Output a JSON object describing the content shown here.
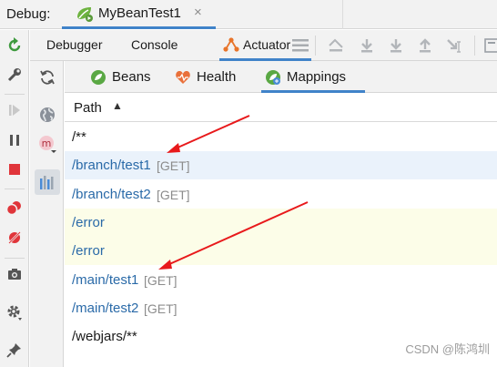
{
  "debug_bar": {
    "label": "Debug:",
    "session_tab": {
      "label": "MyBeanTest1",
      "close": "×"
    }
  },
  "toolbar": {
    "tabs": [
      {
        "label": "Debugger"
      },
      {
        "label": "Console"
      },
      {
        "label": "Actuator",
        "active": true
      }
    ]
  },
  "actuator_tabs": [
    {
      "label": "Beans"
    },
    {
      "label": "Health"
    },
    {
      "label": "Mappings",
      "active": true
    }
  ],
  "table": {
    "header": {
      "label": "Path",
      "sort_indicator": "▲"
    },
    "rows": [
      {
        "path": "/**",
        "method": "",
        "style": "black"
      },
      {
        "path": "/branch/test1",
        "method": "[GET]",
        "style": "blue"
      },
      {
        "path": "/branch/test2",
        "method": "[GET]",
        "style": "blue"
      },
      {
        "path": "/error",
        "method": "",
        "style": "blue"
      },
      {
        "path": "/error",
        "method": "",
        "style": "blue"
      },
      {
        "path": "/main/test1",
        "method": "[GET]",
        "style": "blue"
      },
      {
        "path": "/main/test2",
        "method": "[GET]",
        "style": "blue"
      },
      {
        "path": "/webjars/**",
        "method": "",
        "style": "black"
      }
    ]
  },
  "watermark": "CSDN @陈鸿圳",
  "colors": {
    "accent": "#4083c9",
    "selected_row": "#eaf2fb",
    "highlight_row": "#fcfde8",
    "annotation_arrow": "#e8191b",
    "link_text": "#2a6aa8"
  }
}
